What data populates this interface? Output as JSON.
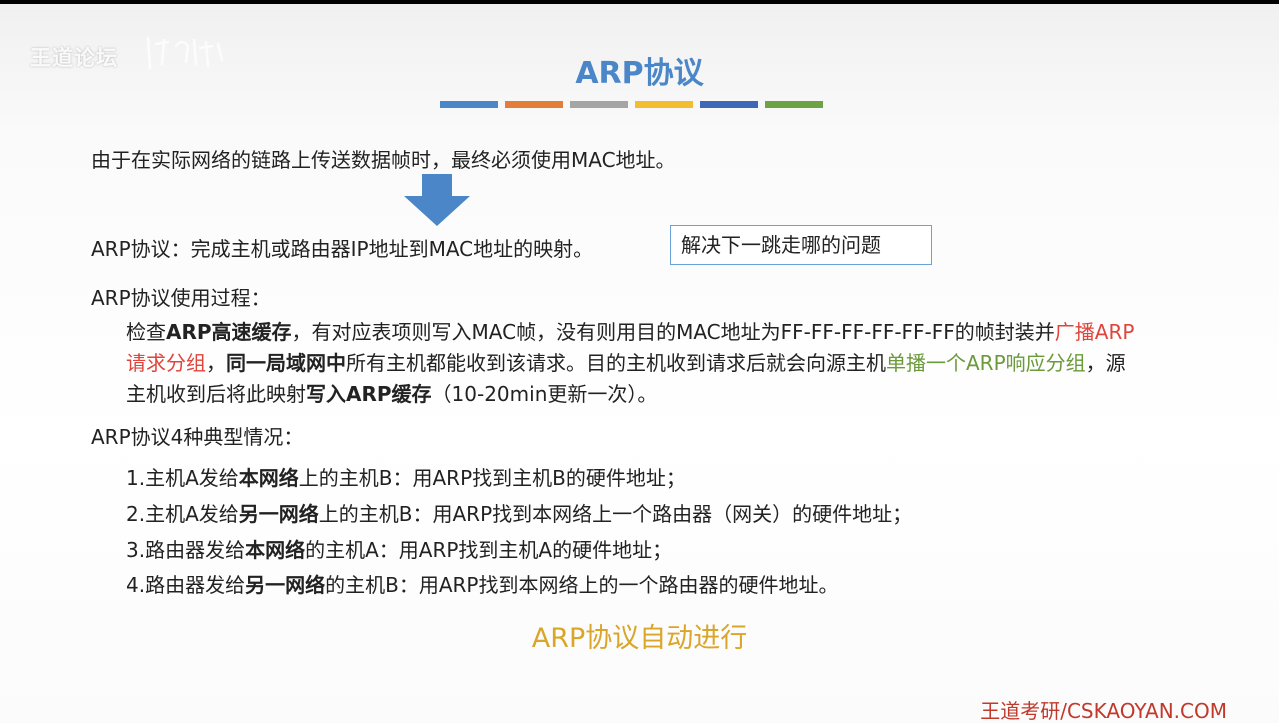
{
  "watermark": "王道论坛",
  "title": "ARP协议",
  "color_bars": [
    "#4a86c8",
    "#e37d3a",
    "#a5a5a5",
    "#f2be2f",
    "#3e67b5",
    "#6ea345"
  ],
  "line1": "由于在实际网络的链路上传送数据帧时，最终必须使用MAC地址。",
  "arrow_icon": "down-arrow-icon",
  "definition": "ARP协议：完成主机或路由器IP地址到MAC地址的映射。",
  "boxed_note": "解决下一跳走哪的问题",
  "process_heading": "ARP协议使用过程：",
  "process": {
    "p1": "检查",
    "b1": "ARP高速缓存",
    "p2": "，有对应表项则写入MAC帧，没有则用目的MAC地址为FF-FF-FF-FF-FF-FF的帧封装并",
    "r1": "广播ARP请求分组",
    "p3": "，",
    "b2": "同一局域网中",
    "p4": "所有主机都能收到该请求。目的主机收到请求后就会向源主机",
    "g1": "单播一个ARP响应分组",
    "p5": "，源主机收到后将此映射",
    "b3": "写入ARP缓存",
    "p6": "（10-20min更新一次）。"
  },
  "cases_heading": "ARP协议4种典型情况：",
  "cases": [
    {
      "pre": "1.主机A发给",
      "bold": "本网络",
      "post": "上的主机B：用ARP找到主机B的硬件地址；"
    },
    {
      "pre": "2.主机A发给",
      "bold": "另一网络",
      "post": "上的主机B：用ARP找到本网络上一个路由器（网关）的硬件地址；"
    },
    {
      "pre": "3.路由器发给",
      "bold": "本网络",
      "post": "的主机A：用ARP找到主机A的硬件地址；"
    },
    {
      "pre": "4.路由器发给",
      "bold": "另一网络",
      "post": "的主机B：用ARP找到本网络上的一个路由器的硬件地址。"
    }
  ],
  "auto_note": "ARP协议自动进行",
  "brand": "王道考研/CSKAOYAN.COM"
}
